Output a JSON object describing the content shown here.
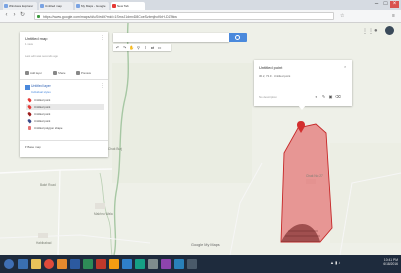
{
  "browser": {
    "tabs": [
      {
        "label": "Windows Explorer"
      },
      {
        "label": "Untitled map"
      },
      {
        "label": "My Maps - Google"
      },
      {
        "label": "New Tab"
      }
    ],
    "url": "https://www.google.com/maps/d/u/0/edit?mid=1SmxJ1dmxD8CoeSzbmjhcKbH-DZ9kw",
    "window_controls": [
      "–",
      "□",
      "×"
    ]
  },
  "map": {
    "search_placeholder": "",
    "place_labels": [
      "Bakri Road",
      "Chak Burj",
      "Makhru Wala",
      "Chak No 27",
      "Habibabad"
    ],
    "brand": "Google My Maps"
  },
  "panel": {
    "title": "Untitled map",
    "subtitle": "1 view",
    "description": "Last edit was seconds ago",
    "actions": {
      "add_layer": "Add layer",
      "share": "Share",
      "preview": "Preview"
    },
    "layer": {
      "name": "Untitled layer",
      "style": "Individual styles",
      "items": [
        {
          "label": "Untitled point",
          "color": "#e53935"
        },
        {
          "label": "Untitled point",
          "color": "#e53935"
        },
        {
          "label": "Untitled point",
          "color": "#9c1b1b"
        },
        {
          "label": "Untitled point",
          "color": "#3a4a8a"
        },
        {
          "label": "Untitled polygon shape",
          "color": "#e57373"
        }
      ]
    },
    "base_map": "Base map"
  },
  "card": {
    "title": "Untitled point",
    "coords": "30.2, 73.9 · Untitled point",
    "footer": "No description",
    "icons": [
      "paint-icon",
      "pencil-icon",
      "camera-icon",
      "trash-icon"
    ]
  },
  "taskbar": {
    "time": "10:41 PM",
    "date": "6/18/2016",
    "apps": [
      "start",
      "ie",
      "explorer",
      "chrome",
      "media",
      "word",
      "excel",
      "paint",
      "vlc",
      "folder",
      "settings",
      "store",
      "photos",
      "mail"
    ]
  },
  "colors": {
    "polygon_fill": "#e57373",
    "polygon_stroke": "#c62828",
    "map_bg": "#eef0e8",
    "taskbar": "#1e2b3d",
    "search_button": "#4a89dc"
  }
}
